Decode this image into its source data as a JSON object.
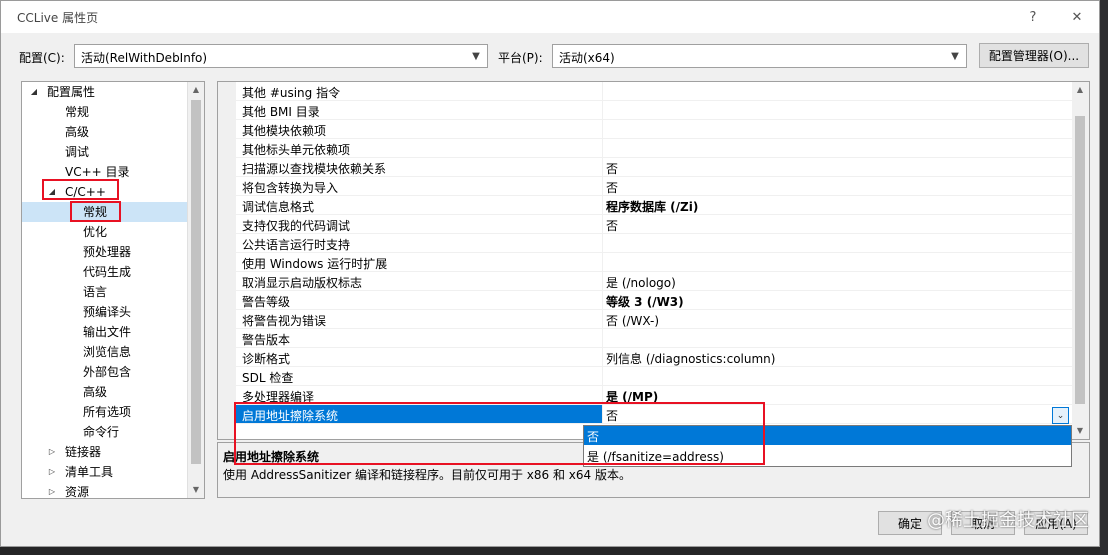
{
  "window": {
    "title": "CCLive 属性页",
    "help_label": "?",
    "close_label": "✕"
  },
  "toolbar": {
    "config_label": "配置(C):",
    "config_value": "活动(RelWithDebInfo)",
    "platform_label": "平台(P):",
    "platform_value": "活动(x64)",
    "config_manager_label": "配置管理器(O)..."
  },
  "tree": {
    "items": [
      {
        "label": "配置属性",
        "expander": "◢",
        "level": 0
      },
      {
        "label": "常规",
        "level": 1
      },
      {
        "label": "高级",
        "level": 1
      },
      {
        "label": "调试",
        "level": 1
      },
      {
        "label": "VC++ 目录",
        "level": 1
      },
      {
        "label": "C/C++",
        "expander": "◢",
        "level": 1
      },
      {
        "label": "常规",
        "level": 2,
        "selected": true
      },
      {
        "label": "优化",
        "level": 2
      },
      {
        "label": "预处理器",
        "level": 2
      },
      {
        "label": "代码生成",
        "level": 2
      },
      {
        "label": "语言",
        "level": 2
      },
      {
        "label": "预编译头",
        "level": 2
      },
      {
        "label": "输出文件",
        "level": 2
      },
      {
        "label": "浏览信息",
        "level": 2
      },
      {
        "label": "外部包含",
        "level": 2
      },
      {
        "label": "高级",
        "level": 2
      },
      {
        "label": "所有选项",
        "level": 2
      },
      {
        "label": "命令行",
        "level": 2
      },
      {
        "label": "链接器",
        "expander": "▷",
        "level": 1
      },
      {
        "label": "清单工具",
        "expander": "▷",
        "level": 1
      },
      {
        "label": "资源",
        "expander": "▷",
        "level": 1
      }
    ]
  },
  "properties": {
    "rows": [
      {
        "name": "其他 #using 指令",
        "value": ""
      },
      {
        "name": "其他 BMI 目录",
        "value": ""
      },
      {
        "name": "其他模块依赖项",
        "value": ""
      },
      {
        "name": "其他标头单元依赖项",
        "value": ""
      },
      {
        "name": "扫描源以查找模块依赖关系",
        "value": "否"
      },
      {
        "name": "将包含转换为导入",
        "value": "否"
      },
      {
        "name": "调试信息格式",
        "value": "程序数据库 (/Zi)",
        "bold": true
      },
      {
        "name": "支持仅我的代码调试",
        "value": "否"
      },
      {
        "name": "公共语言运行时支持",
        "value": ""
      },
      {
        "name": "使用 Windows 运行时扩展",
        "value": ""
      },
      {
        "name": "取消显示启动版权标志",
        "value": "是 (/nologo)"
      },
      {
        "name": "警告等级",
        "value": "等级 3 (/W3)",
        "bold": true
      },
      {
        "name": "将警告视为错误",
        "value": "否 (/WX-)"
      },
      {
        "name": "警告版本",
        "value": ""
      },
      {
        "name": "诊断格式",
        "value": "列信息 (/diagnostics:column)"
      },
      {
        "name": "SDL 检查",
        "value": ""
      },
      {
        "name": "多处理器编译",
        "value": "是 (/MP)",
        "bold": true
      },
      {
        "name": "启用地址擦除系统",
        "value": "否",
        "active": true
      }
    ],
    "dropdown_arrow": "⌄"
  },
  "dropdown": {
    "options": [
      {
        "label": "否",
        "selected": true
      },
      {
        "label": "是 (/fsanitize=address)"
      }
    ]
  },
  "description": {
    "title": "启用地址擦除系统",
    "text": "使用 AddressSanitizer 编译和链接程序。目前仅可用于 x86 和 x64 版本。"
  },
  "footer": {
    "ok_label": "确定",
    "cancel_label": "取消",
    "apply_label": "应用(A)"
  },
  "watermark": "@稀土掘金技术社区"
}
